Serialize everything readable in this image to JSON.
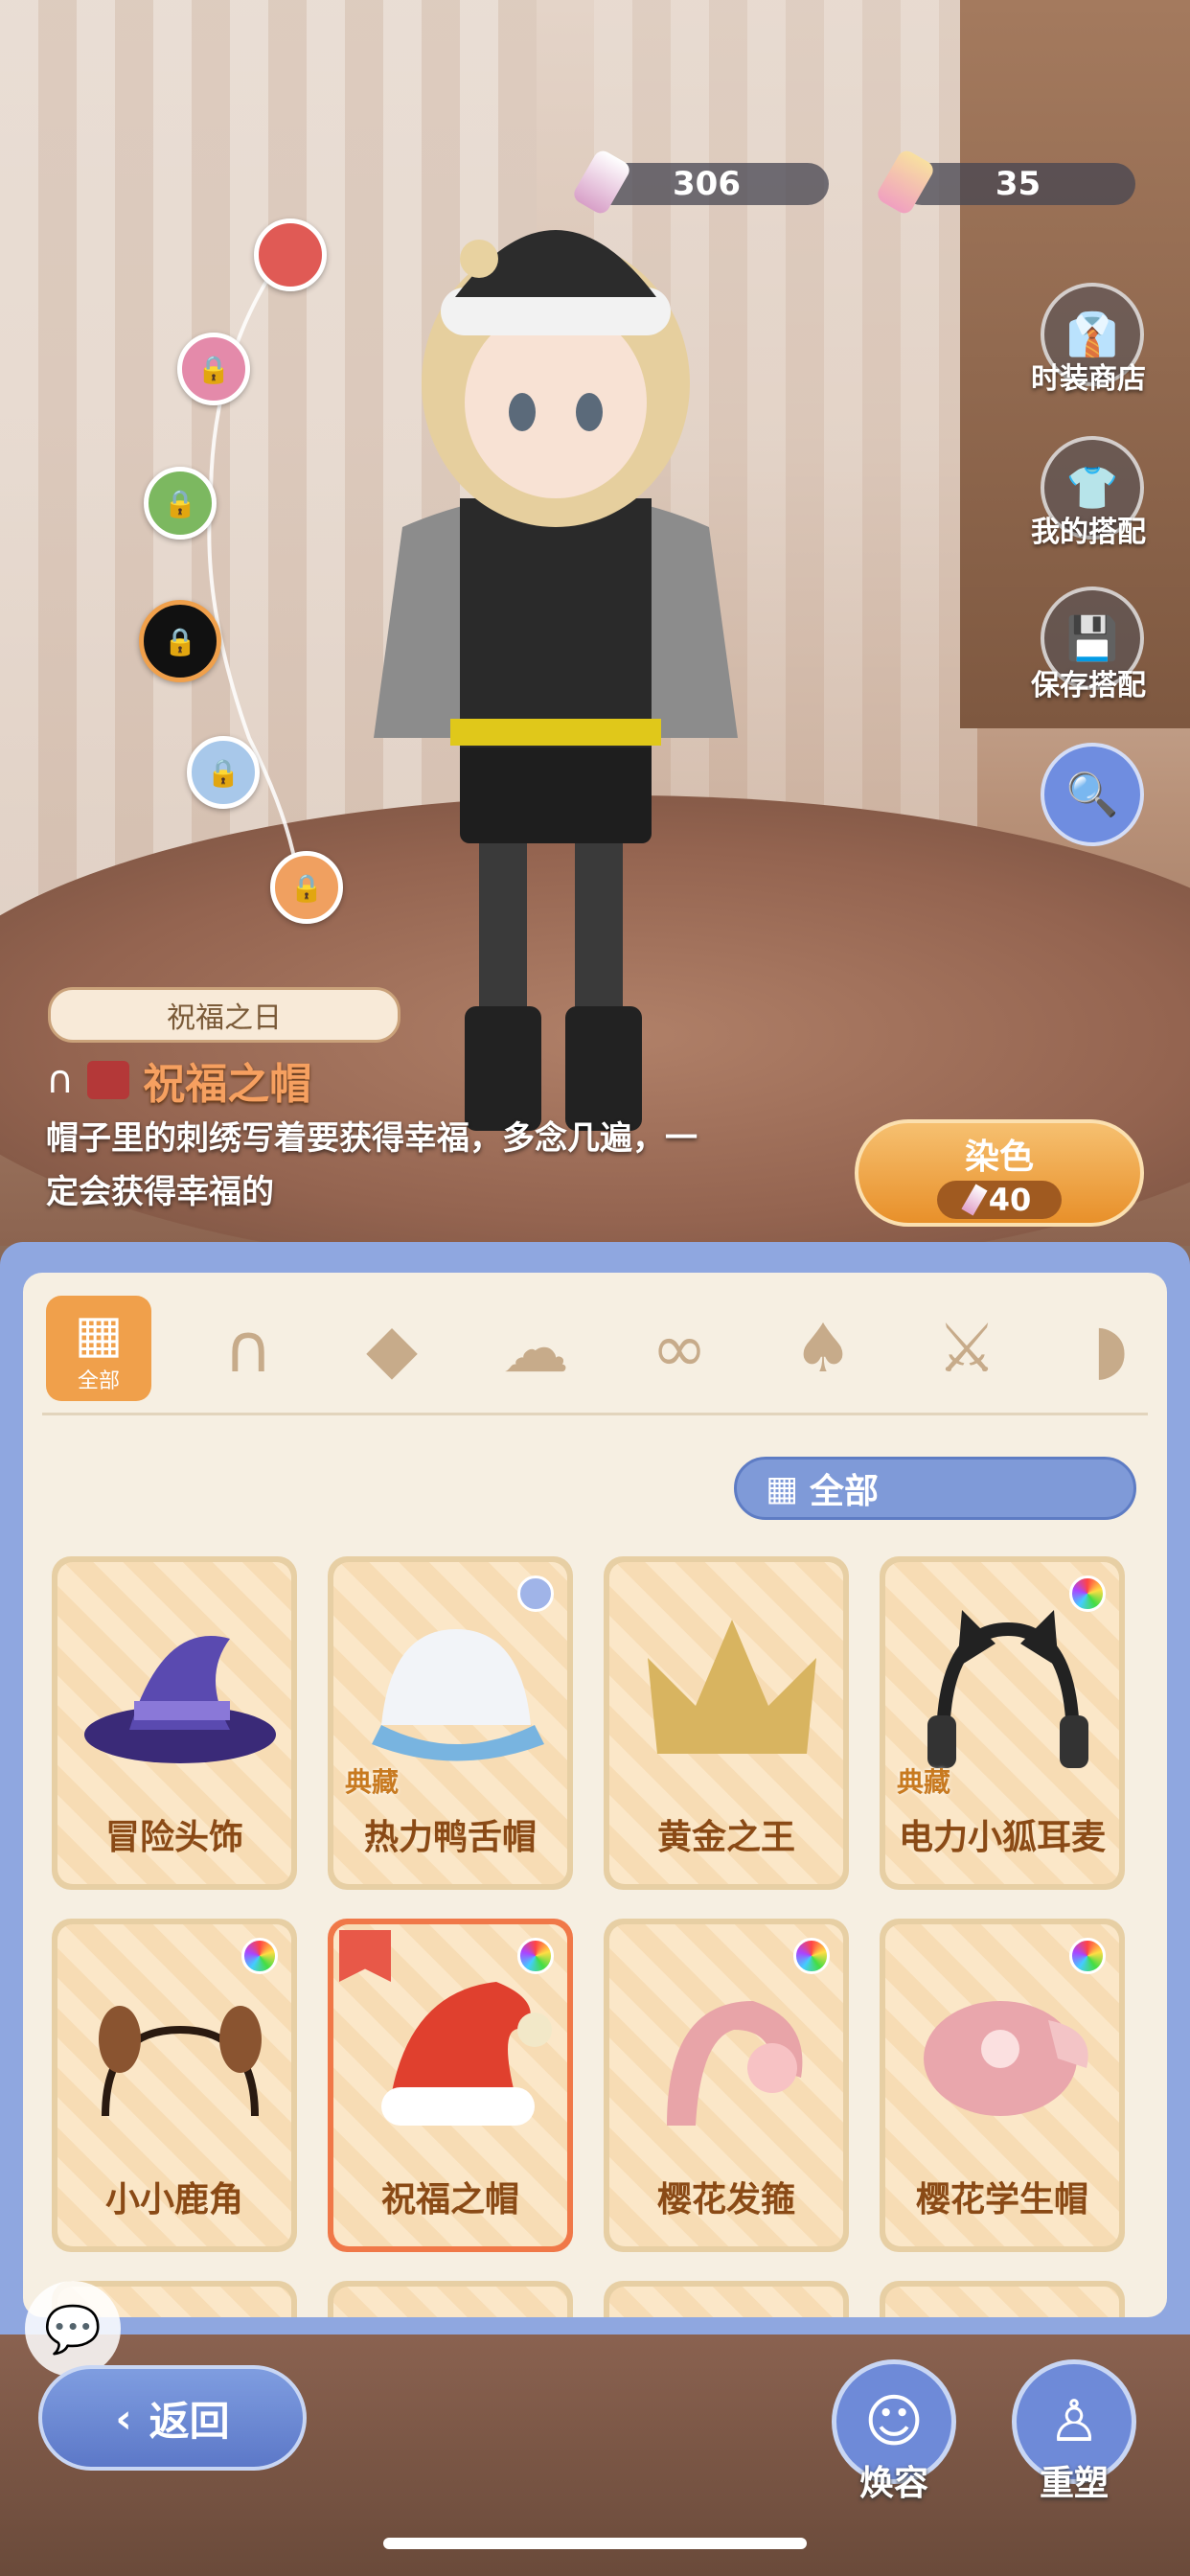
{
  "currency": {
    "primary": "306",
    "secondary": "35"
  },
  "right_menu": [
    {
      "label": "时装商店",
      "icon": "fashion-shop-icon"
    },
    {
      "label": "我的搭配",
      "icon": "wardrobe-hanger-icon"
    },
    {
      "label": "保存搭配",
      "icon": "save-icon"
    }
  ],
  "outfit_set": "祝福之日",
  "selected_item": {
    "name": "祝福之帽",
    "description_line1": "帽子里的刺绣写着要获得幸福，多念几遍，一",
    "description_line2": "定会获得幸福的"
  },
  "dye": {
    "label": "染色",
    "cost": "40"
  },
  "categories": {
    "selected_label": "全部",
    "icons": [
      "all-icon",
      "cat-ears-icon",
      "fox-mask-icon",
      "hair-icon",
      "eye-mask-icon",
      "top-icon",
      "sword-icon",
      "more-icon"
    ]
  },
  "filter": {
    "label": "全部"
  },
  "items": [
    {
      "name": "冒险头饰",
      "tag": "",
      "dot": ""
    },
    {
      "name": "热力鸭舌帽",
      "tag": "典藏",
      "dot": "#a0b4e8"
    },
    {
      "name": "黄金之王",
      "tag": "",
      "dot": ""
    },
    {
      "name": "电力小狐耳麦",
      "tag": "典藏",
      "dot": "rainbow"
    },
    {
      "name": "小小鹿角",
      "tag": "",
      "dot": "rainbow"
    },
    {
      "name": "祝福之帽",
      "tag": "",
      "dot": "rainbow"
    },
    {
      "name": "樱花发箍",
      "tag": "",
      "dot": "rainbow"
    },
    {
      "name": "樱花学生帽",
      "tag": "",
      "dot": "rainbow"
    }
  ],
  "bottom": {
    "back": "返回",
    "face": "焕容",
    "reshape": "重塑"
  },
  "colors": {
    "accent": "#f0a04b",
    "panel": "#8fa7e0",
    "item_text": "#8a4a16"
  }
}
